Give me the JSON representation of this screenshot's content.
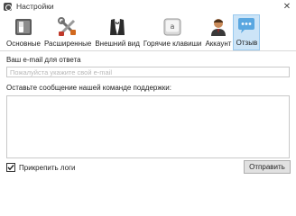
{
  "window": {
    "title": "Настройки",
    "close_glyph": "✕"
  },
  "toolbar": {
    "tabs": [
      {
        "label": "Основные",
        "icon": "settings-switch-icon"
      },
      {
        "label": "Расширенные",
        "icon": "tools-icon"
      },
      {
        "label": "Внешний вид",
        "icon": "tuxedo-icon"
      },
      {
        "label": "Горячие клавиши",
        "icon": "keyboard-key-icon"
      },
      {
        "label": "Аккаунт",
        "icon": "user-account-icon"
      },
      {
        "label": "Отзыв",
        "icon": "speech-bubble-icon",
        "active": true
      }
    ]
  },
  "form": {
    "email_label": "Ваш e-mail для ответа",
    "email_placeholder": "Пожалуйста укажите свой e-mail",
    "email_value": "",
    "message_label": "Оставьте сообщение нашей команде поддержки:",
    "message_value": "",
    "attach_logs_label": "Прикрепить логи",
    "attach_logs_checked": true,
    "send_label": "Отправить"
  },
  "colors": {
    "active_tab_bg": "#cce4f7",
    "active_tab_border": "#99c9ef",
    "input_border": "#c8c8c8",
    "button_bg": "#e1e1e1"
  }
}
